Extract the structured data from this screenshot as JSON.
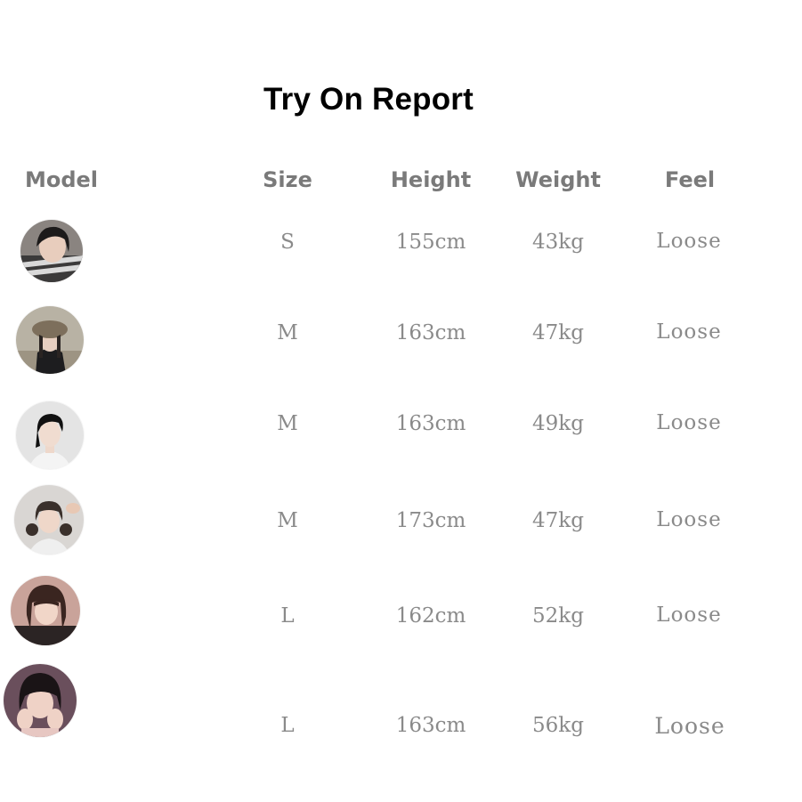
{
  "title": "Try On Report",
  "headers": {
    "model": "Model",
    "size": "Size",
    "height": "Height",
    "weight": "Weight",
    "feel": "Feel"
  },
  "rows": [
    {
      "avatar_icon": "model-photo-1",
      "size": "S",
      "height": "155cm",
      "weight": "43kg",
      "feel": "Loose"
    },
    {
      "avatar_icon": "model-photo-2",
      "size": "M",
      "height": "163cm",
      "weight": "47kg",
      "feel": "Loose"
    },
    {
      "avatar_icon": "model-photo-3",
      "size": "M",
      "height": "163cm",
      "weight": "49kg",
      "feel": "Loose"
    },
    {
      "avatar_icon": "model-photo-4",
      "size": "M",
      "height": "173cm",
      "weight": "47kg",
      "feel": "Loose"
    },
    {
      "avatar_icon": "model-photo-5",
      "size": "L",
      "height": "162cm",
      "weight": "52kg",
      "feel": "Loose"
    },
    {
      "avatar_icon": "model-photo-6",
      "size": "L",
      "height": "163cm",
      "weight": "56kg",
      "feel": "Loose"
    }
  ],
  "colors": {
    "header_text": "#7a7a7a",
    "cell_text": "#8a8a8a",
    "title_text": "#000000",
    "background": "#ffffff"
  }
}
